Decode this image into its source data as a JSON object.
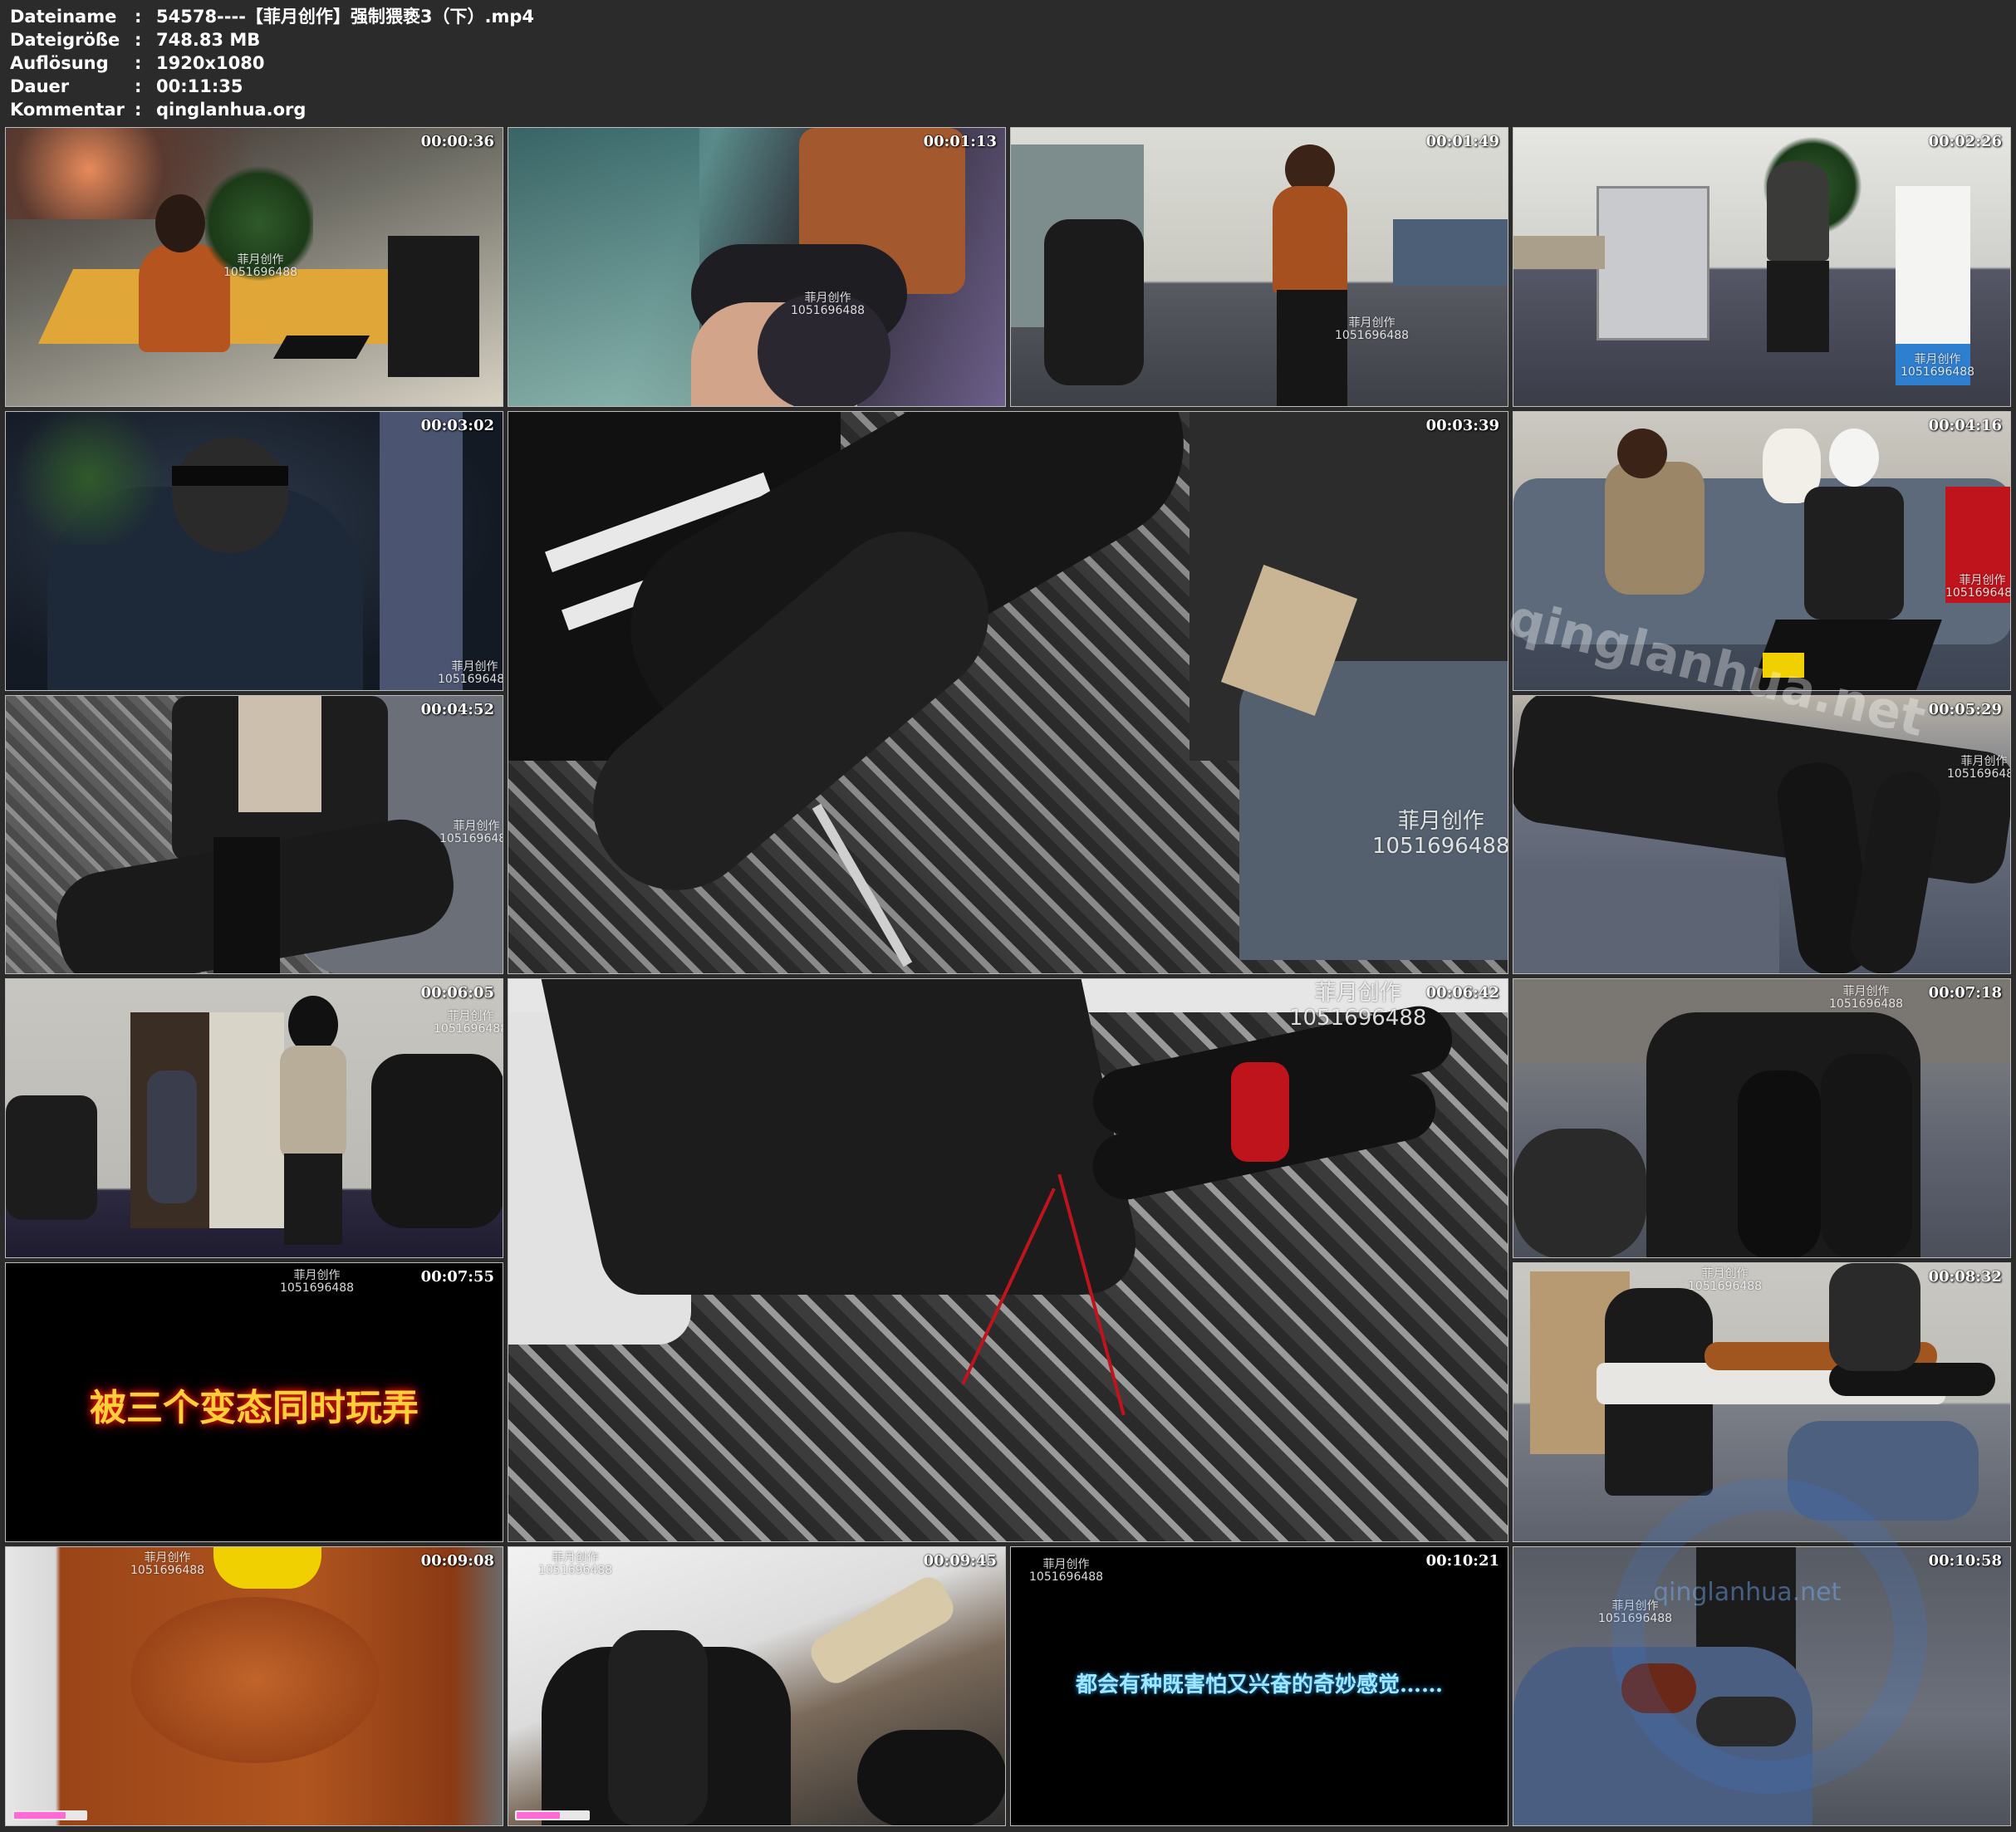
{
  "info": {
    "rows": [
      {
        "key": "Dateiname",
        "colon": ":",
        "value": "54578----【菲月创作】强制猥亵3（下）.mp4"
      },
      {
        "key": "Dateigröße",
        "colon": ":",
        "value": "748.83 MB"
      },
      {
        "key": "Auflösung",
        "colon": ":",
        "value": "1920x1080"
      },
      {
        "key": "Dauer",
        "colon": ":",
        "value": "00:11:35"
      },
      {
        "key": "Kommentar",
        "colon": ":",
        "value": "qinglanhua.org"
      }
    ]
  },
  "watermark": {
    "line1": "菲月创作",
    "line2": "1051696488"
  },
  "site_watermark": "qinglanhua.net",
  "site_watermark2": "qinglanhua.net",
  "captions": {
    "t0755": "被三个变态同时玩弄",
    "t1021": "都会有种既害怕又兴奋的奇妙感觉……"
  },
  "thumbnails": [
    {
      "id": "t0036",
      "time": "00:00:36",
      "scene": "office-desk"
    },
    {
      "id": "t0113",
      "time": "00:01:13",
      "scene": "closeup-skirt"
    },
    {
      "id": "t0149",
      "time": "00:01:49",
      "scene": "office-room"
    },
    {
      "id": "t0226",
      "time": "00:02:26",
      "scene": "office-printer"
    },
    {
      "id": "t0302",
      "time": "00:03:02",
      "scene": "masked-man"
    },
    {
      "id": "t0339",
      "time": "00:03:39",
      "scene": "boots-closeup-large"
    },
    {
      "id": "t0416",
      "time": "00:04:16",
      "scene": "sofa-scene"
    },
    {
      "id": "t0452",
      "time": "00:04:52",
      "scene": "man-on-sofa"
    },
    {
      "id": "t0529",
      "time": "00:05:29",
      "scene": "boots-on-sofa"
    },
    {
      "id": "t0605",
      "time": "00:06:05",
      "scene": "doorway"
    },
    {
      "id": "t0642",
      "time": "00:06:42",
      "scene": "tied-boots-large"
    },
    {
      "id": "t0718",
      "time": "00:07:18",
      "scene": "boots-closeup"
    },
    {
      "id": "t0755",
      "time": "00:07:55",
      "scene": "title-card"
    },
    {
      "id": "t0832",
      "time": "00:08:32",
      "scene": "massage-table"
    },
    {
      "id": "t0908",
      "time": "00:09:08",
      "scene": "sweater-closeup"
    },
    {
      "id": "t0945",
      "time": "00:09:45",
      "scene": "chair-closeup"
    },
    {
      "id": "t1021",
      "time": "00:10:21",
      "scene": "caption-card"
    },
    {
      "id": "t1058",
      "time": "00:10:58",
      "scene": "floor-closeup"
    }
  ],
  "progress_bars": {
    "t0908": 0.72,
    "t0945": 0.6
  },
  "colors": {
    "background": "#2b2b2b",
    "text": "#ffffff",
    "accent_red": "#c0141c"
  }
}
